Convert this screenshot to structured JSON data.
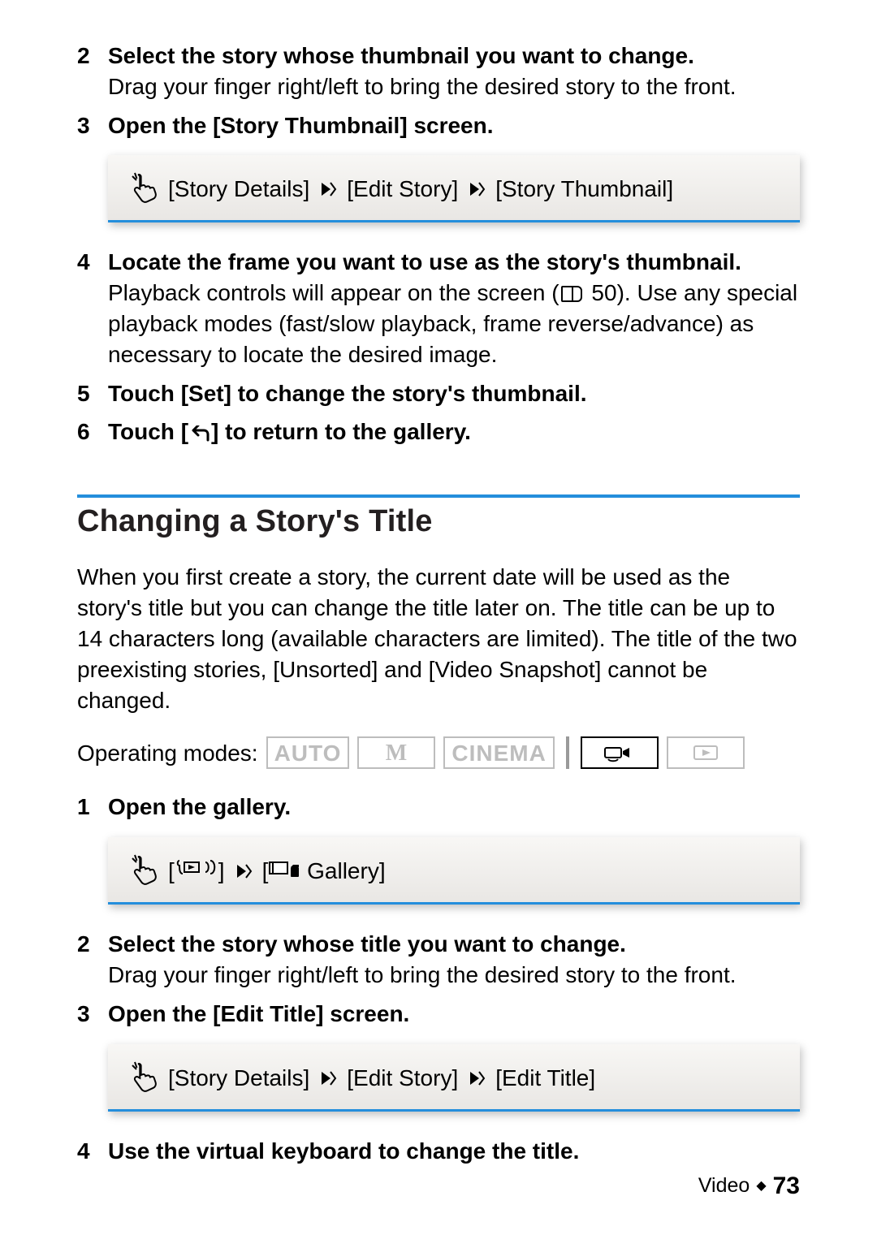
{
  "steps_top": [
    {
      "num": "2",
      "title": "Select the story whose thumbnail you want to change.",
      "desc": "Drag your finger right/left to bring the desired story to the front."
    },
    {
      "num": "3",
      "title": "Open the [Story Thumbnail] screen.",
      "desc": ""
    },
    {
      "num": "4",
      "title": "Locate the frame you want to use as the story's thumbnail.",
      "desc_parts": {
        "before": "Playback controls will appear on the screen (",
        "ref": " 50",
        "after": "). Use any special playback modes (fast/slow playback, frame reverse/advance) as necessary to locate the desired image."
      }
    },
    {
      "num": "5",
      "title": "Touch [Set] to change the story's thumbnail.",
      "desc": ""
    },
    {
      "num": "6",
      "title_parts": {
        "before": "Touch [",
        "after": "] to return to the gallery."
      },
      "desc": ""
    }
  ],
  "touch_path_top": {
    "item1": "[Story Details]",
    "item2": "[Edit Story]",
    "item3": "[Story Thumbnail]"
  },
  "section": {
    "title": "Changing a Story's Title",
    "intro": "When you first create a story, the current date will be used as the story's title but you can change the title later on. The title can be up to 14 characters long (available characters are limited). The title of the two preexisting stories, [Unsorted] and [Video Snapshot] cannot be changed."
  },
  "modes": {
    "label": "Operating modes:",
    "items": [
      "AUTO",
      "M",
      "CINEMA"
    ],
    "icon_camcorder": "camcorder-icon",
    "icon_play": "play-icon"
  },
  "steps_bottom": [
    {
      "num": "1",
      "title": "Open the gallery.",
      "desc": ""
    },
    {
      "num": "2",
      "title": "Select the story whose title you want to change.",
      "desc": "Drag your finger right/left to bring the desired story to the front."
    },
    {
      "num": "3",
      "title": "Open the [Edit Title] screen.",
      "desc": ""
    },
    {
      "num": "4",
      "title": "Use the virtual keyboard to change the title.",
      "desc": ""
    }
  ],
  "touch_path_gallery": {
    "item1_label": "index-switch-icon",
    "item2_suffix": " Gallery]",
    "item2_prefix": "["
  },
  "touch_path_edit_title": {
    "item1": "[Story Details]",
    "item2": "[Edit Story]",
    "item3": "[Edit Title]"
  },
  "footer": {
    "section": "Video",
    "page": "73"
  }
}
